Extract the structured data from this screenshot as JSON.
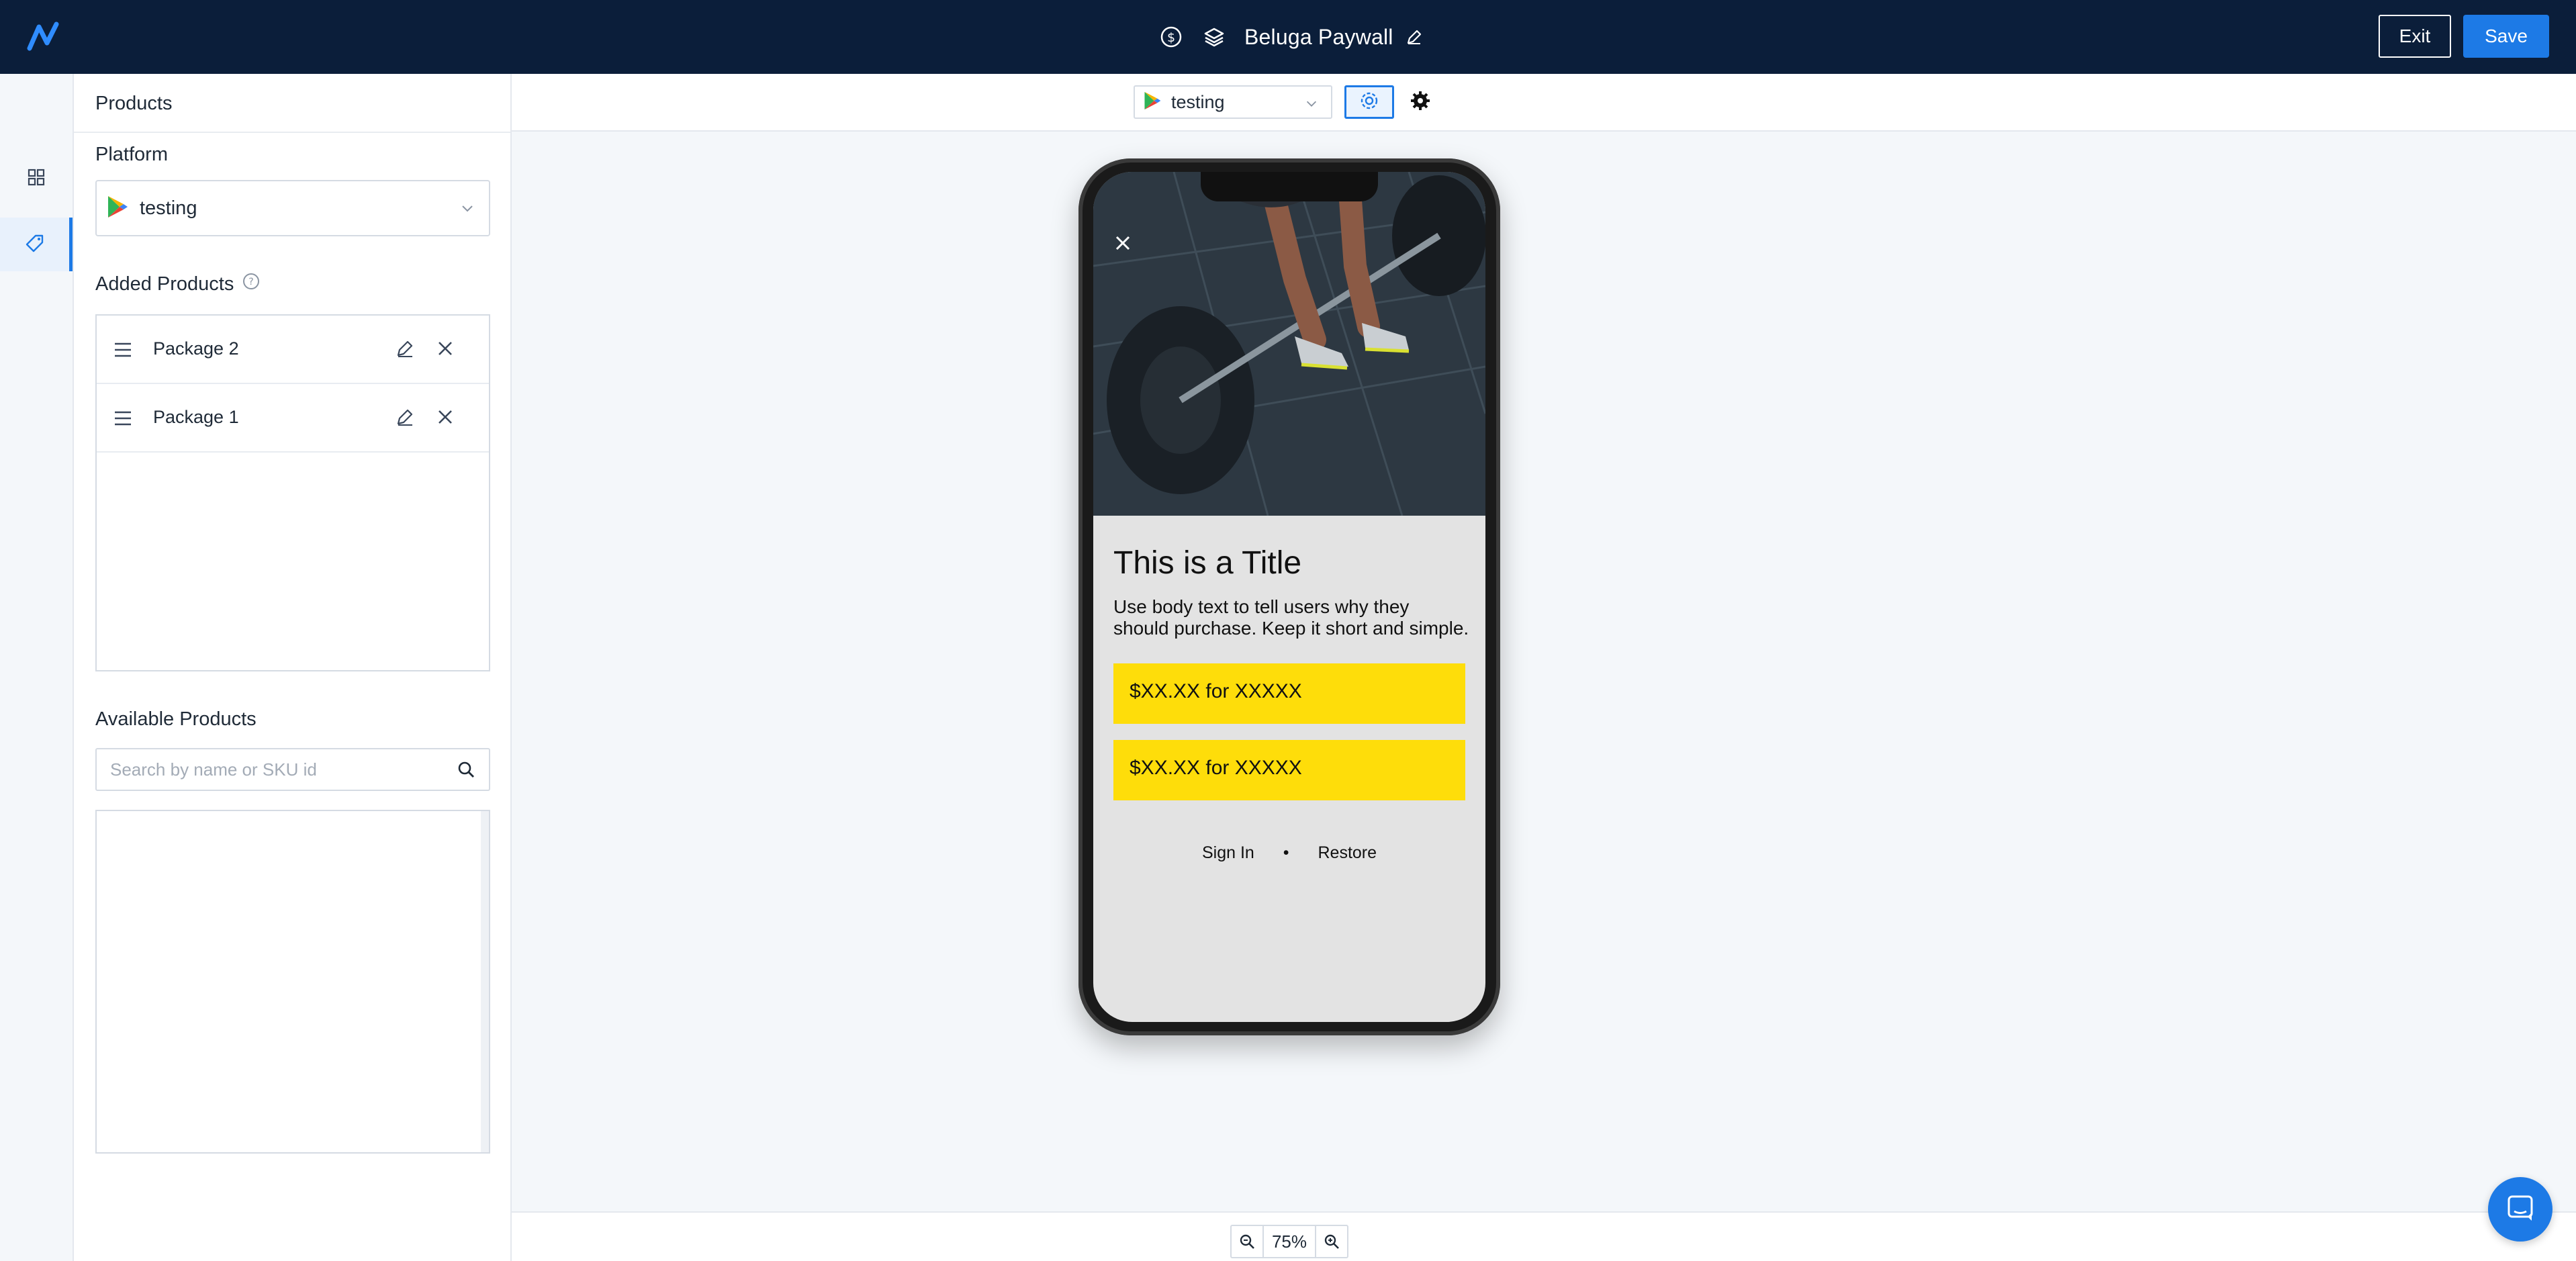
{
  "header": {
    "title": "Beluga Paywall",
    "exit_label": "Exit",
    "save_label": "Save"
  },
  "sidebar": {
    "products_title": "Products",
    "platform_label": "Platform",
    "platform_value": "testing",
    "added_products_label": "Added Products",
    "added_products": [
      {
        "name": "Package 2"
      },
      {
        "name": "Package 1"
      }
    ],
    "available_products_label": "Available Products",
    "search_placeholder": "Search by name or SKU id"
  },
  "toolbar": {
    "platform_value": "testing"
  },
  "preview": {
    "title": "This is a Title",
    "body": "Use body text to tell users why they should purchase. Keep it short and simple.",
    "buttons": [
      {
        "label": "$XX.XX for XXXXX"
      },
      {
        "label": "$XX.XX for XXXXX"
      }
    ],
    "sign_in": "Sign In",
    "separator": "•",
    "restore": "Restore"
  },
  "zoom": {
    "value": "75%"
  },
  "colors": {
    "topbar": "#0b1e3a",
    "accent": "#1d7ae6",
    "cta_yellow": "#fedd0a"
  }
}
